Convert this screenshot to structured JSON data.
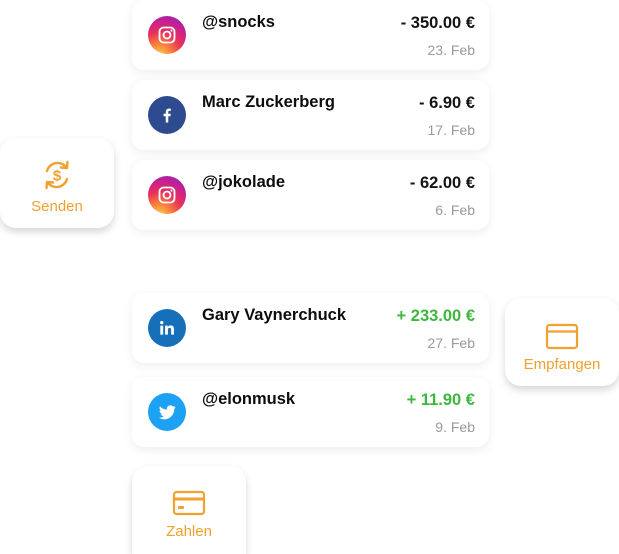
{
  "transactions_outgoing": [
    {
      "name": "@snocks",
      "amount": "- 350.00 €",
      "date": "23. Feb",
      "icon": "instagram-icon"
    },
    {
      "name": "Marc Zuckerberg",
      "amount": "- 6.90 €",
      "date": "17. Feb",
      "icon": "facebook-icon"
    },
    {
      "name": "@jokolade",
      "amount": "- 62.00 €",
      "date": "6. Feb",
      "icon": "instagram-icon"
    }
  ],
  "transactions_incoming": [
    {
      "name": "Gary Vaynerchuck",
      "amount": "+ 233.00 €",
      "date": "27. Feb",
      "icon": "linkedin-icon"
    },
    {
      "name": "@elonmusk",
      "amount": "+ 11.90 €",
      "date": "9. Feb",
      "icon": "twitter-icon"
    }
  ],
  "actions": {
    "send_label": "Senden",
    "receive_label": "Empfangen",
    "pay_label": "Zahlen"
  },
  "colors": {
    "accent": "#f0a12e",
    "positive": "#3db83d",
    "negative": "#141414",
    "facebook": "#2f4b8f",
    "linkedin": "#1670b9",
    "twitter": "#1da1f2"
  }
}
